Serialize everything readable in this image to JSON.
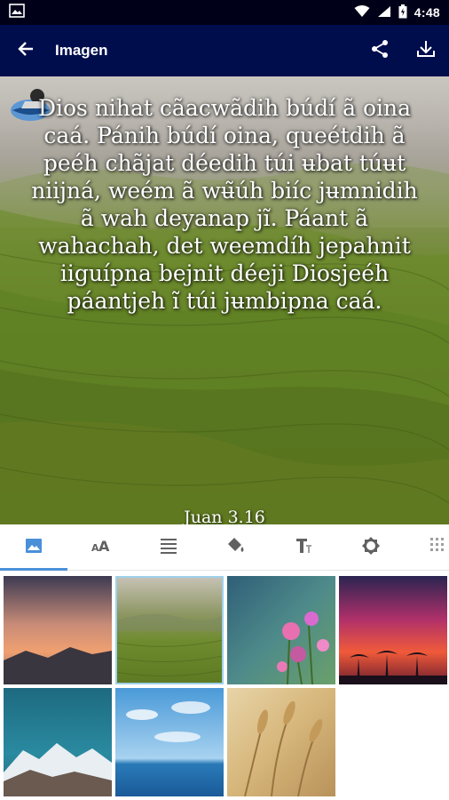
{
  "status_bar": {
    "time": "4:48",
    "icons": [
      "image-icon",
      "wifi-icon",
      "signal-icon",
      "battery-icon"
    ]
  },
  "app_bar": {
    "title": "Imagen",
    "back_icon": "arrow-left-icon",
    "share_icon": "share-icon",
    "download_icon": "download-icon"
  },
  "preview": {
    "verse_text": "Dios nihat cãacwãdih búdí ã oina caá. Pánih búdí oina, queétdih ã peéh chãjat déedih túi ʉbat túʉt niijná, weém ã wʉ̃úh biíc jʉmnidih ã wah deyanap jĩ. Páant ã wahachah, det weemdíh jepahnit iiguípna bejnit déeji Diosjeéh páantjeh ĩ túi jʉmbipna caá.",
    "reference": "Juan 3.16"
  },
  "tabs": [
    {
      "name": "image-icon",
      "active": true
    },
    {
      "name": "text-size-icon",
      "active": false
    },
    {
      "name": "align-icon",
      "active": false
    },
    {
      "name": "paint-bucket-icon",
      "active": false
    },
    {
      "name": "text-style-icon",
      "active": false
    },
    {
      "name": "brightness-icon",
      "active": false
    },
    {
      "name": "texture-icon",
      "active": false
    }
  ],
  "backgrounds": [
    {
      "name": "sunset-mountains",
      "selected": false
    },
    {
      "name": "green-hills",
      "selected": true
    },
    {
      "name": "pink-flowers",
      "selected": false
    },
    {
      "name": "palm-sunset",
      "selected": false
    },
    {
      "name": "snow-mountain",
      "selected": false
    },
    {
      "name": "sky-sea",
      "selected": false
    },
    {
      "name": "wheat-field",
      "selected": false
    }
  ],
  "colors": {
    "status_bar": "#000019",
    "app_bar": "#000d4d",
    "tab_indicator": "#4a90d9",
    "icon_gray": "#616161"
  }
}
